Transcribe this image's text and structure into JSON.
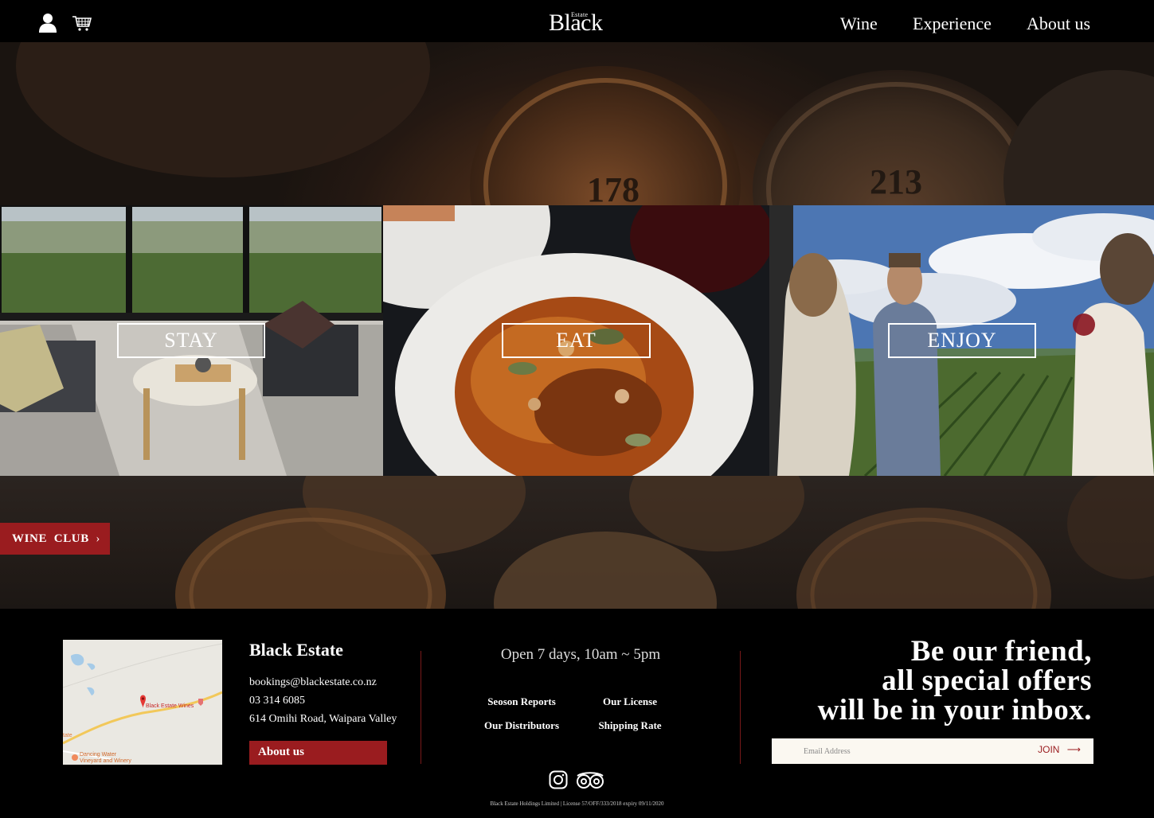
{
  "header": {
    "logo_small": "Estate",
    "logo_main": "Black",
    "nav": [
      {
        "label": "Wine"
      },
      {
        "label": "Experience"
      },
      {
        "label": "About us"
      }
    ],
    "icons": [
      "user-icon",
      "cart-icon"
    ]
  },
  "hero": {
    "barrel_numbers": [
      "178",
      "213"
    ]
  },
  "panels": [
    {
      "label": "STAY"
    },
    {
      "label": "EAT"
    },
    {
      "label": "ENJOY"
    }
  ],
  "wine_club": {
    "label": "WINE  CLUB",
    "chevron": "›"
  },
  "footer": {
    "map": {
      "pin_label": "Black Estate Wines",
      "place_label_1": "Dancing Water",
      "place_label_2": "Vineyard and Winery",
      "place_label_3": "tate"
    },
    "estate": {
      "name": "Black Estate",
      "email": "bookings@blackestate.co.nz",
      "phone": "03 314 6085",
      "address": "614 Omihi Road, Waipara Valley",
      "about_label": "About us"
    },
    "hours": "Open 7 days, 10am ~ 5pm",
    "links": [
      {
        "label": "Seoson Reports"
      },
      {
        "label": "Our License"
      },
      {
        "label": "Our Distributors"
      },
      {
        "label": "Shipping Rate"
      }
    ],
    "promo": {
      "line1": "Be our friend,",
      "line2": "all special offers",
      "line3": "will be in your inbox."
    },
    "newsletter": {
      "placeholder": "Email Address",
      "join_label": "JOIN",
      "arrow": "⟶"
    },
    "social_icons": [
      "instagram-icon",
      "tripadvisor-icon"
    ],
    "legal": "Black Estate Holdings Limited | License 57/OFF/333/2018 expiry 09/11/2020"
  },
  "colors": {
    "accent": "#9a1c1f",
    "background": "#000000"
  }
}
